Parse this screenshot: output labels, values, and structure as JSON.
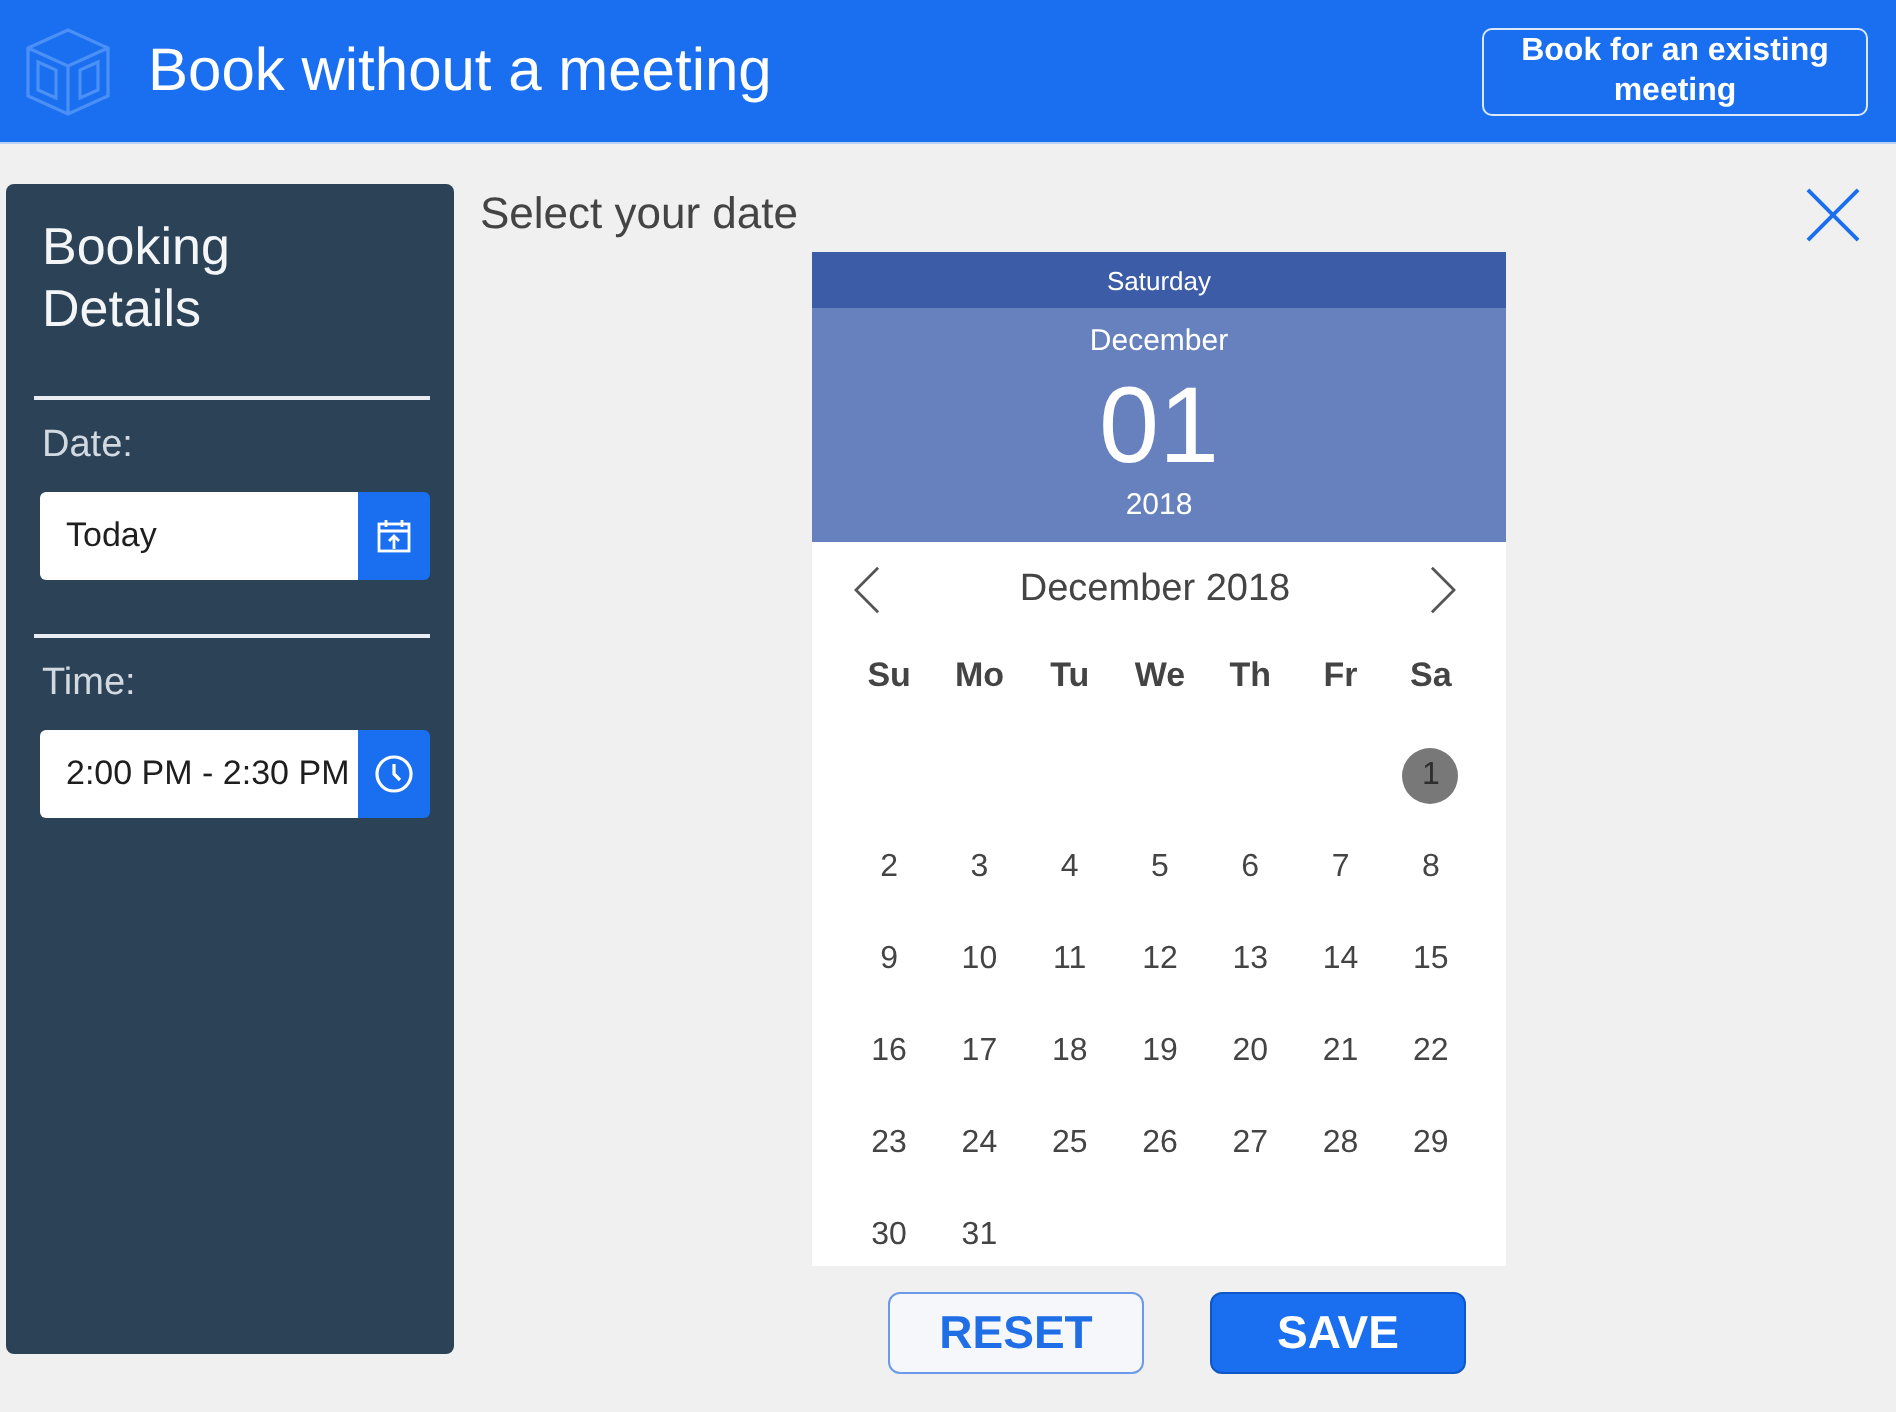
{
  "header": {
    "title": "Book without a meeting",
    "button": "Book for an existing meeting"
  },
  "sidebar": {
    "title": "Booking Details",
    "fields": [
      {
        "kind": "date",
        "label": "Date:",
        "value": "Today"
      },
      {
        "kind": "time",
        "label": "Time:",
        "value": "2:00 PM - 2:30 PM"
      }
    ]
  },
  "main": {
    "heading": "Select your date"
  },
  "calendar": {
    "selected_weekday": "Saturday",
    "selected_month": "December",
    "selected_day": "01",
    "selected_year": "2018",
    "month_title": "December 2018",
    "weekdays": [
      "Su",
      "Mo",
      "Tu",
      "We",
      "Th",
      "Fr",
      "Sa"
    ],
    "weeks": [
      {
        "kind": "first",
        "days": [
          {
            "label": "1",
            "selected": true
          }
        ]
      },
      {
        "kind": "full",
        "days": [
          {
            "label": "2",
            "selected": false
          },
          {
            "label": "3",
            "selected": false
          },
          {
            "label": "4",
            "selected": false
          },
          {
            "label": "5",
            "selected": false
          },
          {
            "label": "6",
            "selected": false
          },
          {
            "label": "7",
            "selected": false
          },
          {
            "label": "8",
            "selected": false
          }
        ]
      },
      {
        "kind": "full",
        "days": [
          {
            "label": "9",
            "selected": false
          },
          {
            "label": "10",
            "selected": false
          },
          {
            "label": "11",
            "selected": false
          },
          {
            "label": "12",
            "selected": false
          },
          {
            "label": "13",
            "selected": false
          },
          {
            "label": "14",
            "selected": false
          },
          {
            "label": "15",
            "selected": false
          }
        ]
      },
      {
        "kind": "full",
        "days": [
          {
            "label": "16",
            "selected": false
          },
          {
            "label": "17",
            "selected": false
          },
          {
            "label": "18",
            "selected": false
          },
          {
            "label": "19",
            "selected": false
          },
          {
            "label": "20",
            "selected": false
          },
          {
            "label": "21",
            "selected": false
          },
          {
            "label": "22",
            "selected": false
          }
        ]
      },
      {
        "kind": "full",
        "days": [
          {
            "label": "23",
            "selected": false
          },
          {
            "label": "24",
            "selected": false
          },
          {
            "label": "25",
            "selected": false
          },
          {
            "label": "26",
            "selected": false
          },
          {
            "label": "27",
            "selected": false
          },
          {
            "label": "28",
            "selected": false
          },
          {
            "label": "29",
            "selected": false
          }
        ]
      },
      {
        "kind": "last",
        "days": [
          {
            "label": "30",
            "selected": false
          },
          {
            "label": "31",
            "selected": false
          }
        ]
      }
    ]
  },
  "buttons": [
    {
      "kind": "secondary",
      "label": "RESET"
    },
    {
      "kind": "primary",
      "label": "SAVE"
    }
  ]
}
